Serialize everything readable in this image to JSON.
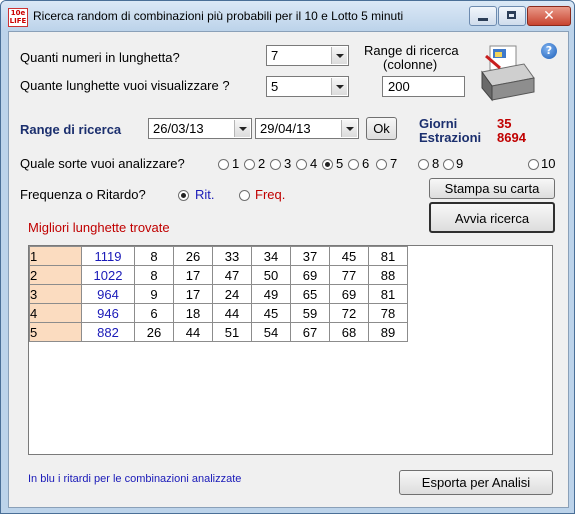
{
  "window": {
    "title": "Ricerca random di combinazioni più probabili per il 10 e Lotto 5 minuti",
    "icon_text_top": "10e",
    "icon_text_bottom": "LIFE",
    "close_glyph": "✕"
  },
  "form": {
    "quanti_label": "Quanti numeri in lunghetta?",
    "quanti_value": "7",
    "quante_label": "Quante lunghette vuoi visualizzare ?",
    "quante_value": "5",
    "range_colonne_label_1": "Range di ricerca",
    "range_colonne_label_2": "(colonne)",
    "range_colonne_value": "200",
    "range_date_label": "Range di ricerca",
    "date_from": "26/03/13",
    "date_to": "29/04/13",
    "ok_label": "Ok",
    "giorni_label": "Giorni",
    "giorni_value": "35",
    "estrazioni_label": "Estrazioni",
    "estrazioni_value": "8694",
    "sorte_label": "Quale sorte vuoi analizzare?",
    "sorte_options": [
      "1",
      "2",
      "3",
      "4",
      "5",
      "6",
      "7",
      "8",
      "9",
      "10"
    ],
    "sorte_selected": "5",
    "freq_label": "Frequenza o Ritardo?",
    "rit_label": "Rit.",
    "freq_option_label": "Freq.",
    "mode_selected": "Rit.",
    "stampa_label": "Stampa su carta",
    "avvia_label": "Avvia ricerca"
  },
  "results": {
    "heading": "Migliori lunghette trovate",
    "rows": [
      {
        "n": "1",
        "rit": "1119",
        "nums": [
          "8",
          "26",
          "33",
          "34",
          "37",
          "45",
          "81"
        ]
      },
      {
        "n": "2",
        "rit": "1022",
        "nums": [
          "8",
          "17",
          "47",
          "50",
          "69",
          "77",
          "88"
        ]
      },
      {
        "n": "3",
        "rit": "964",
        "nums": [
          "9",
          "17",
          "24",
          "49",
          "65",
          "69",
          "81"
        ]
      },
      {
        "n": "4",
        "rit": "946",
        "nums": [
          "6",
          "18",
          "44",
          "45",
          "59",
          "72",
          "78"
        ]
      },
      {
        "n": "5",
        "rit": "882",
        "nums": [
          "26",
          "44",
          "51",
          "54",
          "67",
          "68",
          "89"
        ]
      }
    ]
  },
  "footer": {
    "note": "In blu i ritardi per le combinazioni analizzate",
    "export_label": "Esporta per Analisi"
  },
  "colors": {
    "accent_red": "#c00000",
    "ritardo_blue": "#1a1ab8",
    "row_header_bg": "#fbdcc0",
    "heading_blue": "#1b2f6e"
  },
  "icons": {
    "printer": "printer-icon",
    "help": "help-icon"
  }
}
